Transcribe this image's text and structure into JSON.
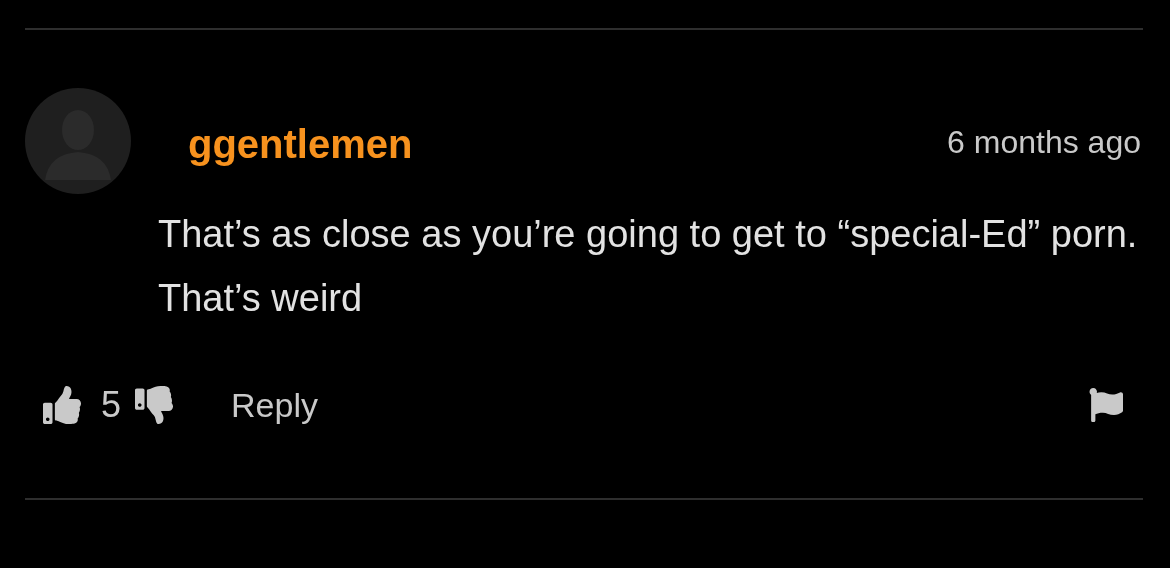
{
  "comment": {
    "username": "ggentlemen",
    "time": "6 months ago",
    "text": "That’s as close as you’re going to get to “special-Ed” porn. That’s weird",
    "votes": "5",
    "reply_label": "Reply"
  }
}
